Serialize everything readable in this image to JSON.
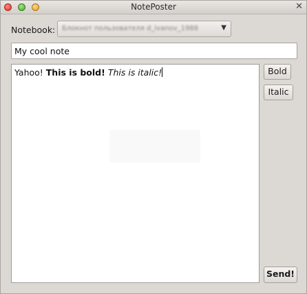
{
  "window": {
    "title": "NotePoster",
    "close_glyph": "✕"
  },
  "notebook": {
    "label": "Notebook:",
    "selected": "Блокнот пользователя d_ivanov_1988",
    "arrow_glyph": "▼"
  },
  "note_title": {
    "value": "My cool note"
  },
  "editor": {
    "plain": "Yahoo! ",
    "bold": "This is bold!",
    "separator": " ",
    "italic": "This is italic!"
  },
  "buttons": {
    "bold": "Bold",
    "italic": "Italic",
    "send": "Send!"
  }
}
